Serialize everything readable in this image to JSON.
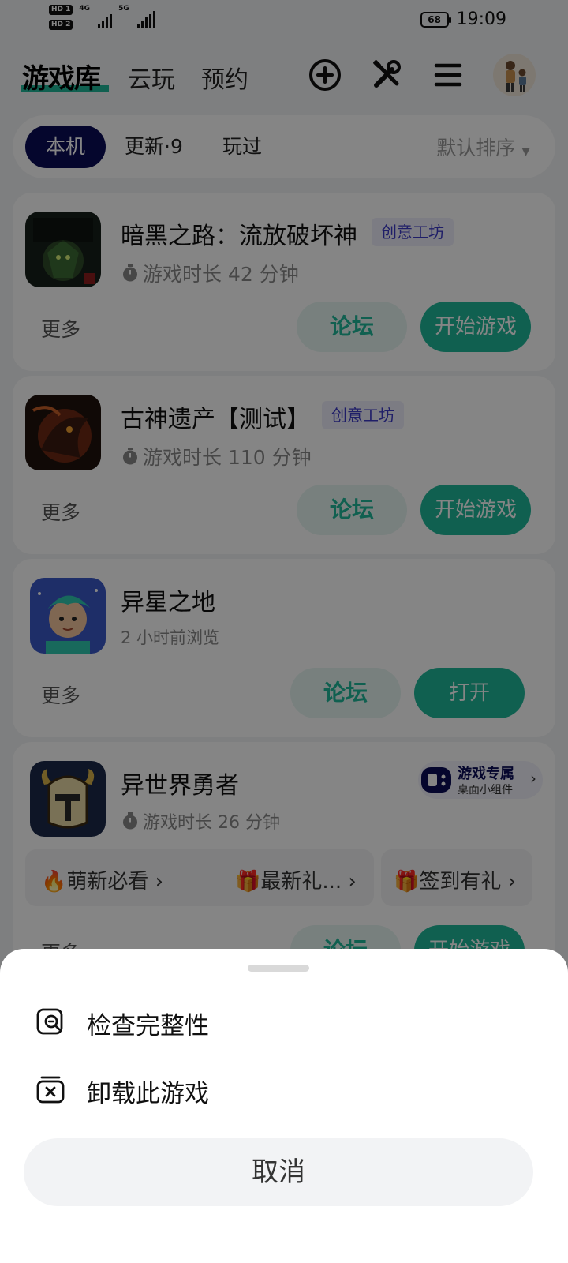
{
  "status_bar": {
    "hd1": "HD 1",
    "hd2": "HD 2",
    "net1": "4G",
    "net2": "5G",
    "battery": "68",
    "time": "19:09"
  },
  "top_nav": {
    "logo": "游戏库",
    "tabs": [
      "云玩",
      "预约"
    ]
  },
  "filter": {
    "tabs": [
      "本机",
      "更新·9",
      "玩过"
    ],
    "active": "本机",
    "sort": "默认排序"
  },
  "games": [
    {
      "title": "暗黑之路：流放破坏神",
      "badge": "创意工坊",
      "subtitle": "游戏时长 42 分钟",
      "more": "更多",
      "forum": "论坛",
      "action": "开始游戏"
    },
    {
      "title": "古神遗产【测试】",
      "badge": "创意工坊",
      "subtitle": "游戏时长 110 分钟",
      "more": "更多",
      "forum": "论坛",
      "action": "开始游戏"
    },
    {
      "title": "异星之地",
      "subtitle": "2 小时前浏览",
      "more": "更多",
      "forum": "论坛",
      "action": "打开"
    },
    {
      "title": "异世界勇者",
      "subtitle": "游戏时长 26 分钟",
      "widget_title": "游戏专属",
      "widget_sub": "桌面小组件",
      "chips": [
        "萌新必看",
        "最新礼...",
        "签到有礼"
      ],
      "more": "更多",
      "forum": "论坛",
      "action": "开始游戏"
    }
  ],
  "sheet": {
    "items": [
      "检查完整性",
      "卸载此游戏"
    ],
    "cancel": "取消"
  },
  "colors": {
    "accent": "#1fb89a",
    "navy": "#0b0d57",
    "badge_text": "#3c3ac8"
  }
}
